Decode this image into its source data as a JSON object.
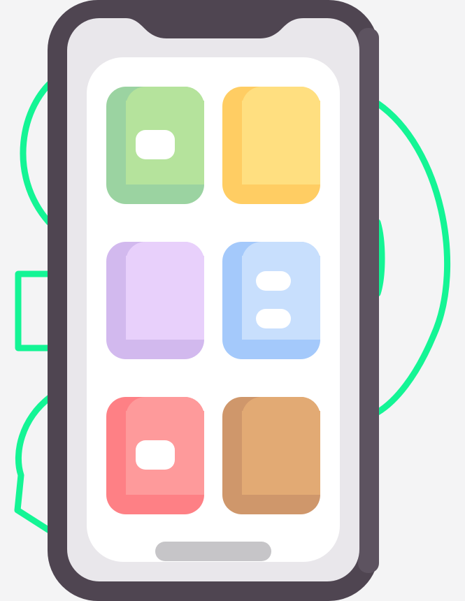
{
  "colors": {
    "background": "#f4f4f5",
    "accent_outline": "#14f595",
    "phone_frame": "#4f4551",
    "phone_frame_side": "#5d5360",
    "screen_bezel": "#e9e7eb",
    "screen": "#ffffff",
    "home_indicator": "#c6c5c8"
  },
  "icons": [
    {
      "name": "app-icon-green",
      "icon": "green-app-tile",
      "color": "#b5e39c",
      "shade": "#9bd3a1",
      "glyph": "single-pill",
      "interactable": true
    },
    {
      "name": "app-icon-yellow",
      "icon": "yellow-app-tile",
      "color": "#ffdf80",
      "shade": "#ffcd63",
      "glyph": "none",
      "interactable": true
    },
    {
      "name": "app-icon-purple",
      "icon": "purple-app-tile",
      "color": "#e8d0fb",
      "shade": "#d2b9ee",
      "glyph": "none",
      "interactable": true
    },
    {
      "name": "app-icon-blue",
      "icon": "blue-app-tile",
      "color": "#c8dffd",
      "shade": "#a4c9fb",
      "glyph": "double-pill",
      "interactable": true
    },
    {
      "name": "app-icon-red",
      "icon": "red-app-tile",
      "color": "#fe9a9b",
      "shade": "#fe8085",
      "glyph": "single-pill",
      "interactable": true
    },
    {
      "name": "app-icon-brown",
      "icon": "brown-app-tile",
      "color": "#e2aa74",
      "shade": "#cf976b",
      "glyph": "none",
      "interactable": true
    }
  ]
}
